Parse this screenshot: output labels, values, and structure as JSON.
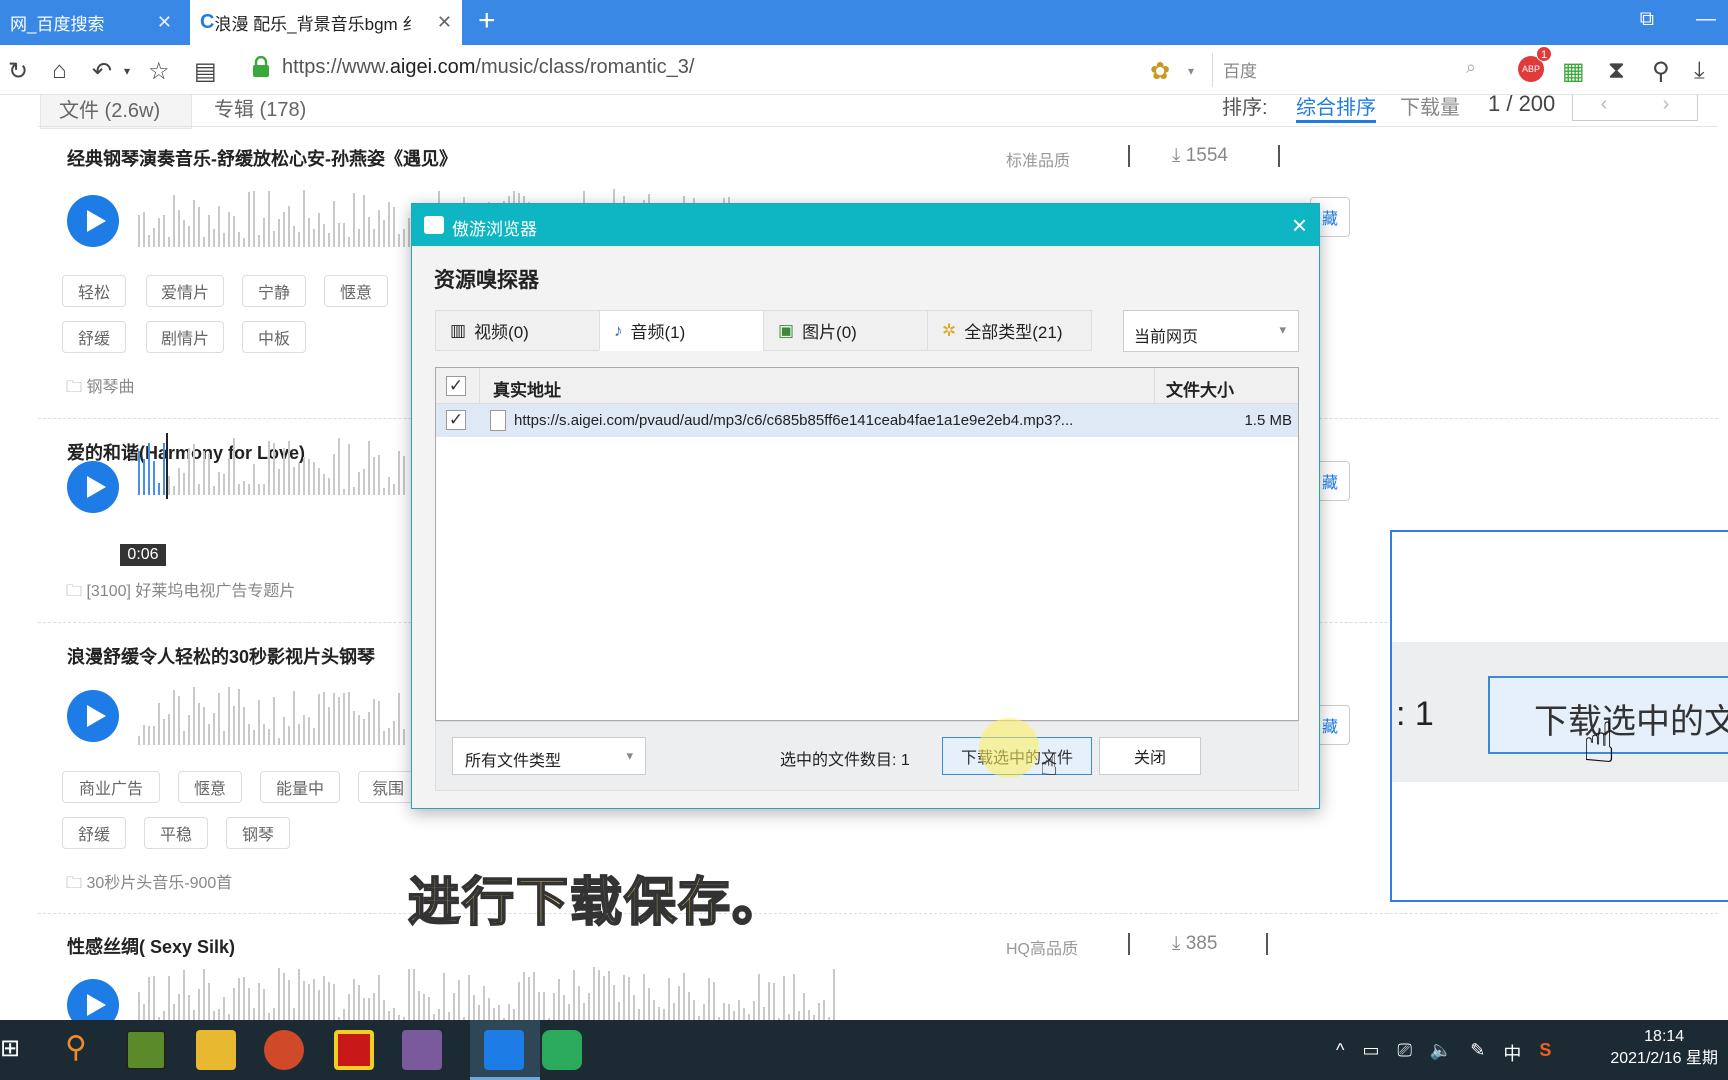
{
  "browser": {
    "tabs": [
      {
        "label": "网_百度搜索",
        "active": false
      },
      {
        "label": "浪漫 配乐_背景音乐bgm 纟",
        "active": true
      }
    ],
    "new_tab_label": "+",
    "url_prefix": "https://www.",
    "url_domain": "aigei.com",
    "url_path": "/music/class/romantic_3/",
    "search_placeholder": "百度",
    "adblock_badge": "1"
  },
  "page": {
    "filter_tabs": [
      "文件 (2.6w)",
      "专辑 (178)"
    ],
    "sort_label": "排序:",
    "sort_options": [
      "综合排序",
      "下载量"
    ],
    "pager": "1 / 200",
    "songs": [
      {
        "title": "经典钢琴演奏音乐-舒缓放松心安-孙燕姿《遇见》",
        "quality": "标准品质",
        "downloads": "1554",
        "tags": [
          "轻松",
          "爱情片",
          "宁静",
          "惬意",
          "舒缓",
          "剧情片",
          "中板"
        ],
        "category": "钢琴曲"
      },
      {
        "title": "爱的和谐(Harmony for Love)",
        "time": "0:06",
        "category": "[3100] 好莱坞电视广告专题片"
      },
      {
        "title": "浪漫舒缓令人轻松的30秒影视片头钢琴",
        "tags": [
          "商业广告",
          "惬意",
          "能量中",
          "氛围",
          "舒缓",
          "平稳",
          "钢琴"
        ],
        "category": "30秒片头音乐-900首"
      },
      {
        "title": "性感丝绸( Sexy Silk)",
        "quality": "HQ高品质",
        "downloads": "385"
      }
    ],
    "partial_buttons": [
      "藏",
      "藏",
      "藏"
    ]
  },
  "dialog": {
    "window_title": "傲游浏览器",
    "heading": "资源嗅探器",
    "tabs": [
      {
        "label": "视频(0)",
        "icon": "film-icon"
      },
      {
        "label": "音频(1)",
        "icon": "music-note-icon"
      },
      {
        "label": "图片(0)",
        "icon": "image-icon"
      },
      {
        "label": "全部类型(21)",
        "icon": "gear-icon"
      }
    ],
    "scope": "当前网页",
    "columns": {
      "address": "真实地址",
      "size": "文件大小"
    },
    "rows": [
      {
        "url": "https://s.aigei.com/pvaud/aud/mp3/c6/c685b85ff6e141ceab4fae1a1e9e2eb4.mp3?...",
        "size": "1.5 MB",
        "checked": true
      }
    ],
    "file_type": "所有文件类型",
    "selected_count": "选中的文件数目: 1",
    "download_button": "下载选中的文件",
    "close_button": "关闭"
  },
  "zoom": {
    "count": ": 1",
    "button": "下载选中的文"
  },
  "subtitle": "进行下载保存。",
  "taskbar": {
    "time": "18:14",
    "date": "2021/2/16 星期",
    "ime": "中"
  },
  "colors": {
    "tabbar": "#3a88e6",
    "dialog_header": "#0eb5c3",
    "play": "#1e7ce6",
    "taskbar": "#1b2a33"
  }
}
